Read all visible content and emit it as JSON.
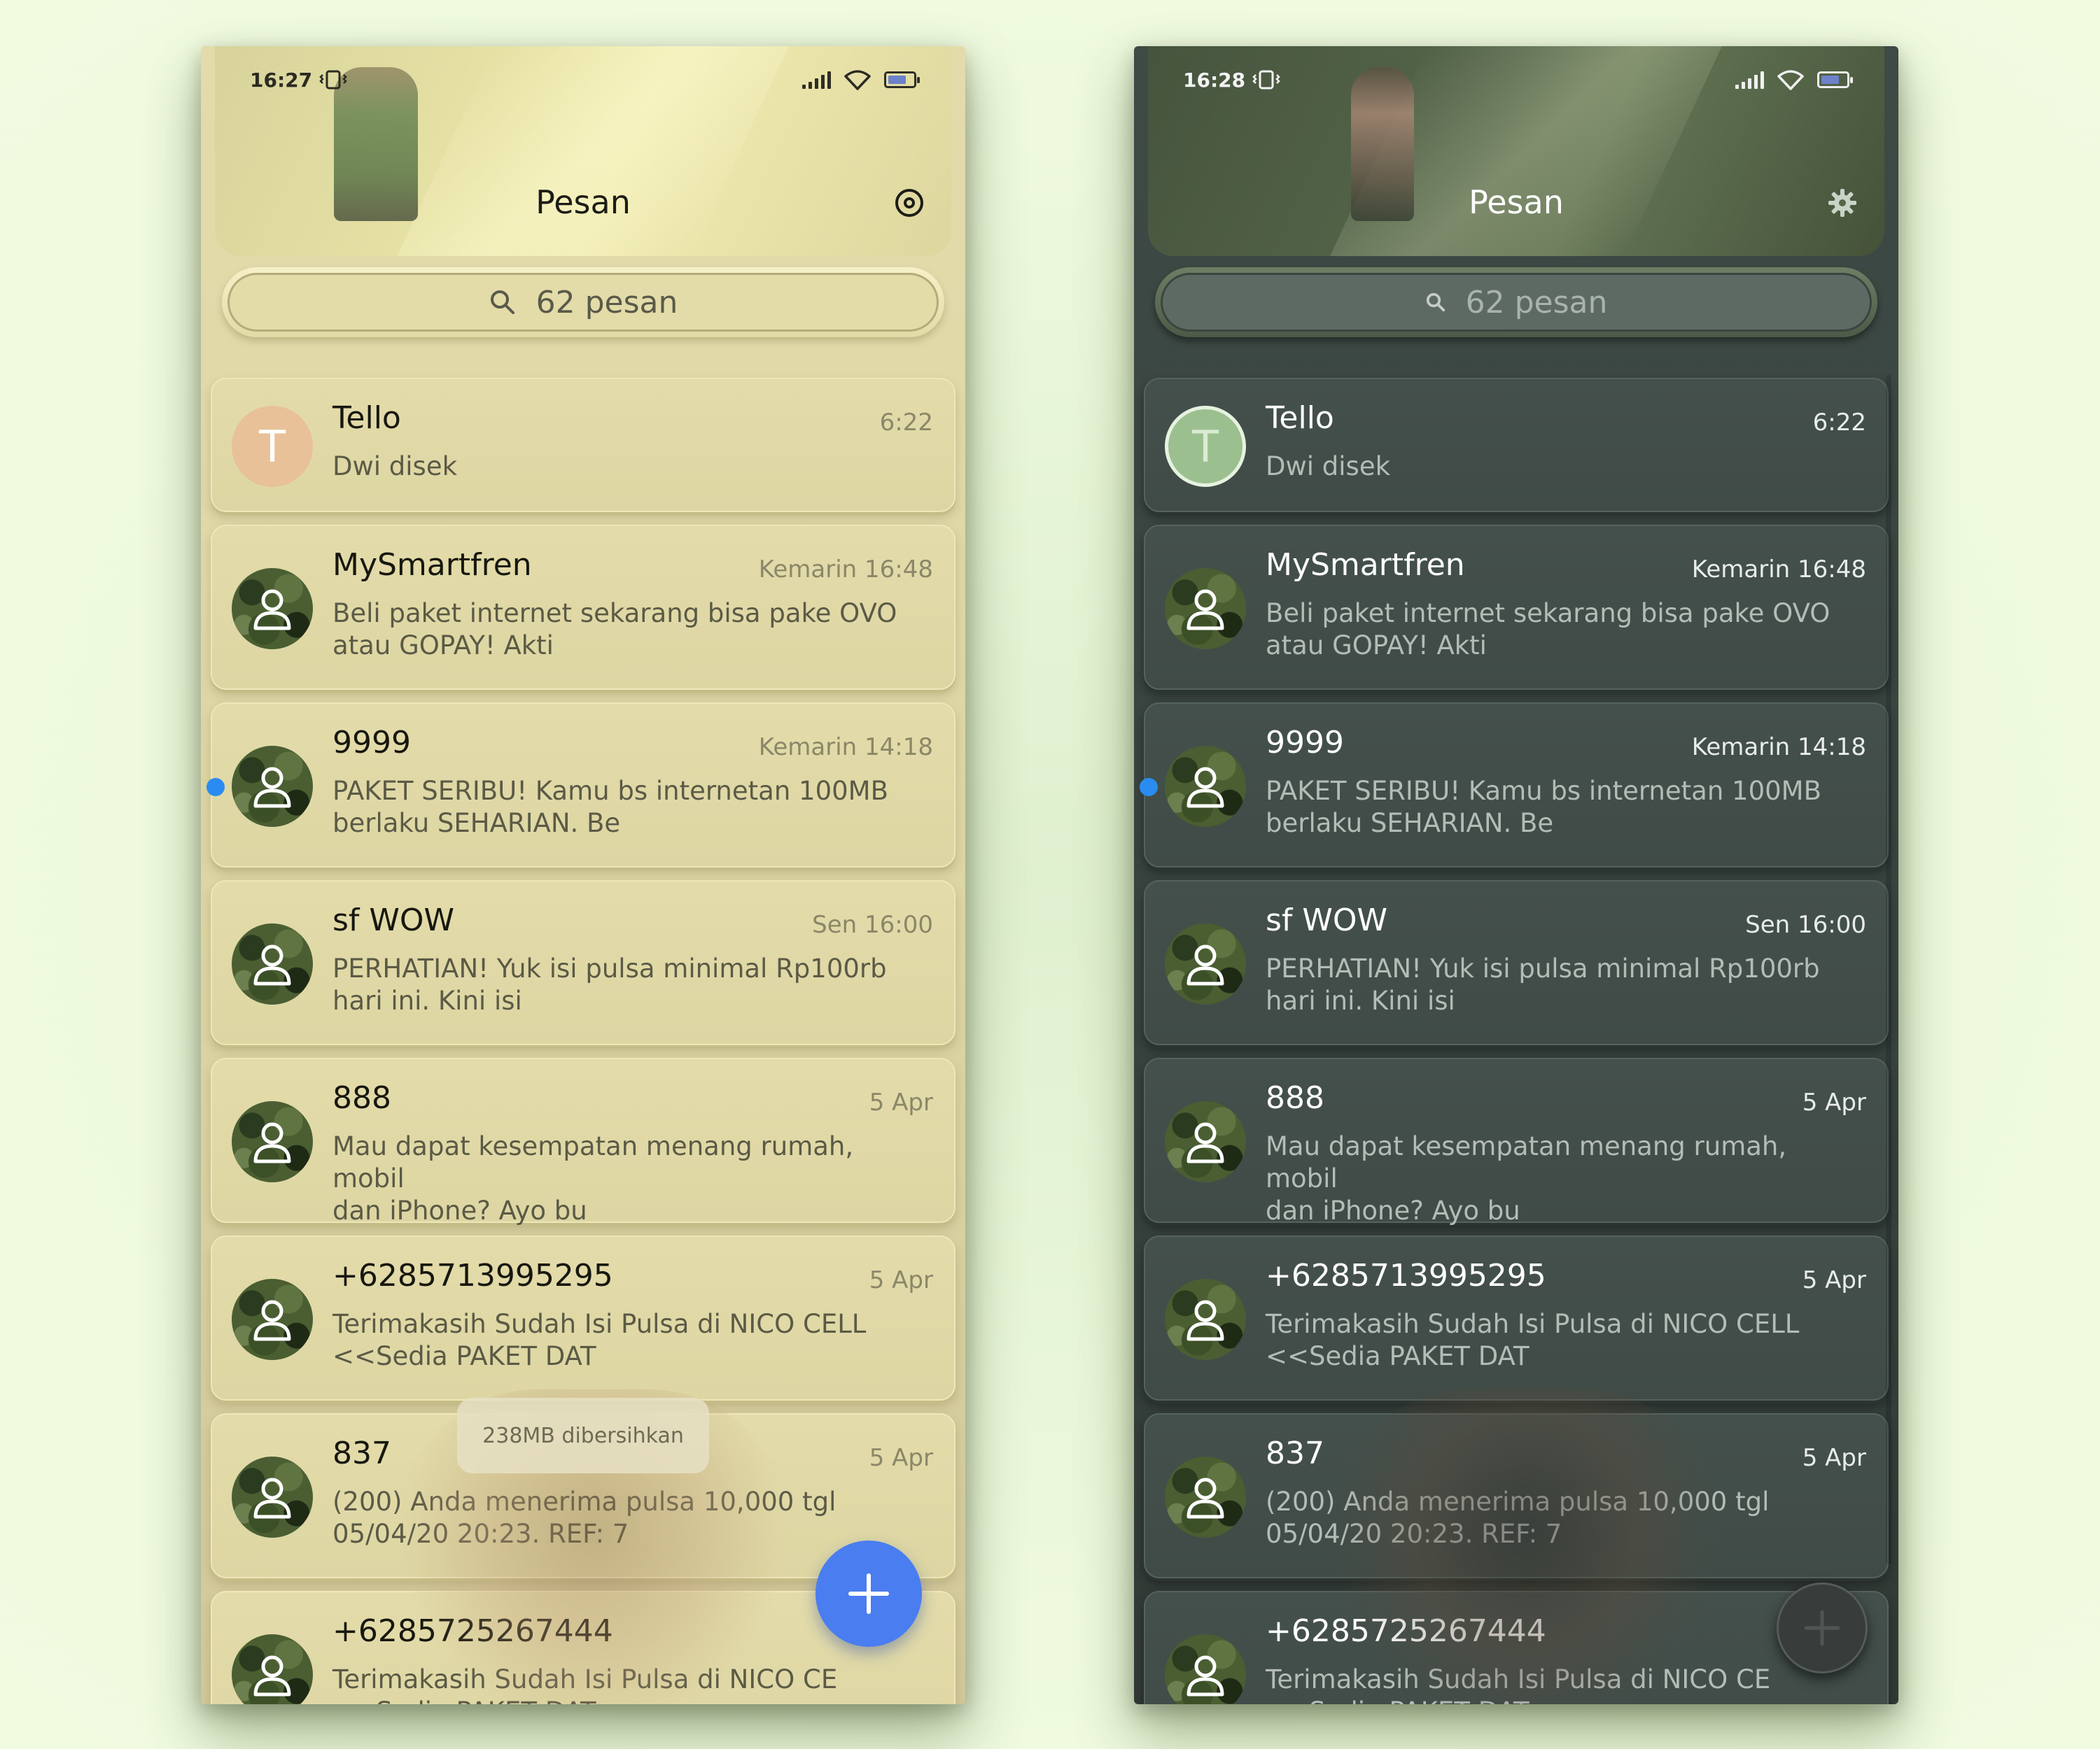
{
  "screens": [
    {
      "theme": "light",
      "status_time": "16:27",
      "title": "Pesan",
      "search_placeholder": "62 pesan",
      "toast": "238MB dibersihkan",
      "conversations": [
        {
          "name": "Tello",
          "time": "6:22",
          "preview": "Dwi disek",
          "avatar": "T",
          "unread": false
        },
        {
          "name": "MySmartfren",
          "time": "Kemarin 16:48",
          "preview": "Beli paket internet sekarang bisa pake OVO\natau GOPAY! Akti",
          "unread": false
        },
        {
          "name": "9999",
          "time": "Kemarin 14:18",
          "preview": "PAKET SERIBU! Kamu bs internetan 100MB\nberlaku SEHARIAN. Be",
          "unread": true
        },
        {
          "name": "sf WOW",
          "time": "Sen 16:00",
          "preview": "PERHATIAN! Yuk isi pulsa minimal Rp100rb\nhari ini. Kini isi",
          "unread": false
        },
        {
          "name": "888",
          "time": "5 Apr",
          "preview": "Mau dapat kesempatan menang rumah, mobil\ndan iPhone? Ayo bu",
          "unread": false
        },
        {
          "name": "+6285713995295",
          "time": "5 Apr",
          "preview": "Terimakasih Sudah Isi Pulsa di  NICO CELL\n<<Sedia PAKET DAT",
          "unread": false
        },
        {
          "name": "837",
          "time": "5 Apr",
          "preview": "(200) Anda menerima pulsa 10,000 tgl\n05/04/20 20:23. REF: 7",
          "unread": false
        },
        {
          "name": "+6285725267444",
          "time": "",
          "preview": "Terimakasih Sudah Isi Pulsa di  NICO CE\n<<Sedia PAKET DAT",
          "unread": false
        }
      ]
    },
    {
      "theme": "dark",
      "status_time": "16:28",
      "title": "Pesan",
      "search_placeholder": "62 pesan",
      "conversations": [
        {
          "name": "Tello",
          "time": "6:22",
          "preview": "Dwi disek",
          "avatar": "T",
          "unread": false
        },
        {
          "name": "MySmartfren",
          "time": "Kemarin 16:48",
          "preview": "Beli paket internet sekarang bisa pake OVO\natau GOPAY! Akti",
          "unread": false
        },
        {
          "name": "9999",
          "time": "Kemarin 14:18",
          "preview": "PAKET SERIBU! Kamu bs internetan 100MB\nberlaku SEHARIAN. Be",
          "unread": true
        },
        {
          "name": "sf WOW",
          "time": "Sen 16:00",
          "preview": "PERHATIAN! Yuk isi pulsa minimal Rp100rb\nhari ini. Kini isi",
          "unread": false
        },
        {
          "name": "888",
          "time": "5 Apr",
          "preview": "Mau dapat kesempatan menang rumah, mobil\ndan iPhone? Ayo bu",
          "unread": false
        },
        {
          "name": "+6285713995295",
          "time": "5 Apr",
          "preview": "Terimakasih Sudah Isi Pulsa di  NICO CELL\n<<Sedia PAKET DAT",
          "unread": false
        },
        {
          "name": "837",
          "time": "5 Apr",
          "preview": "(200) Anda menerima pulsa 10,000 tgl\n05/04/20 20:23. REF: 7",
          "unread": false
        },
        {
          "name": "+6285725267444",
          "time": "",
          "preview": "Terimakasih Sudah Isi Pulsa di  NICO CE\n<<Sedia PAKET DAT",
          "unread": false
        }
      ]
    }
  ],
  "colors": {
    "unread_dot": "#2a8cf0",
    "fab_light": "#4a7df0",
    "fab_dark": "#383d3b"
  }
}
